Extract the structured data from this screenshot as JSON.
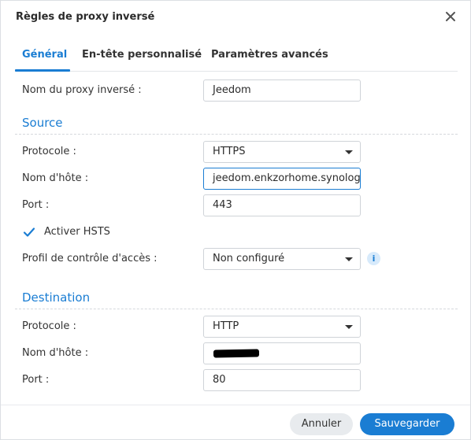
{
  "dialog": {
    "title": "Règles de proxy inversé",
    "close_icon": "close-icon"
  },
  "tabs": [
    {
      "label": "Général",
      "active": true
    },
    {
      "label": "En-tête personnalisé",
      "active": false
    },
    {
      "label": "Paramètres avancés",
      "active": false
    }
  ],
  "general": {
    "name_label": "Nom du proxy inversé :",
    "name_value": "Jeedom"
  },
  "source": {
    "title": "Source",
    "protocol_label": "Protocole :",
    "protocol_value": "HTTPS",
    "hostname_label": "Nom d'hôte :",
    "hostname_value": "jeedom.enkzorhome.synology.me",
    "port_label": "Port :",
    "port_value": "443",
    "hsts_label": "Activer HSTS",
    "hsts_checked": true,
    "access_label": "Profil de contrôle d'accès :",
    "access_value": "Non configuré",
    "info_icon": "info-icon",
    "info_glyph": "i"
  },
  "destination": {
    "title": "Destination",
    "protocol_label": "Protocole :",
    "protocol_value": "HTTP",
    "hostname_label": "Nom d'hôte :",
    "hostname_value": "",
    "port_label": "Port :",
    "port_value": "80"
  },
  "footer": {
    "cancel_label": "Annuler",
    "save_label": "Sauvegarder"
  },
  "colors": {
    "accent": "#1a7dd3",
    "info_bg": "#d7eafb",
    "cancel_bg": "#e8ebee"
  }
}
